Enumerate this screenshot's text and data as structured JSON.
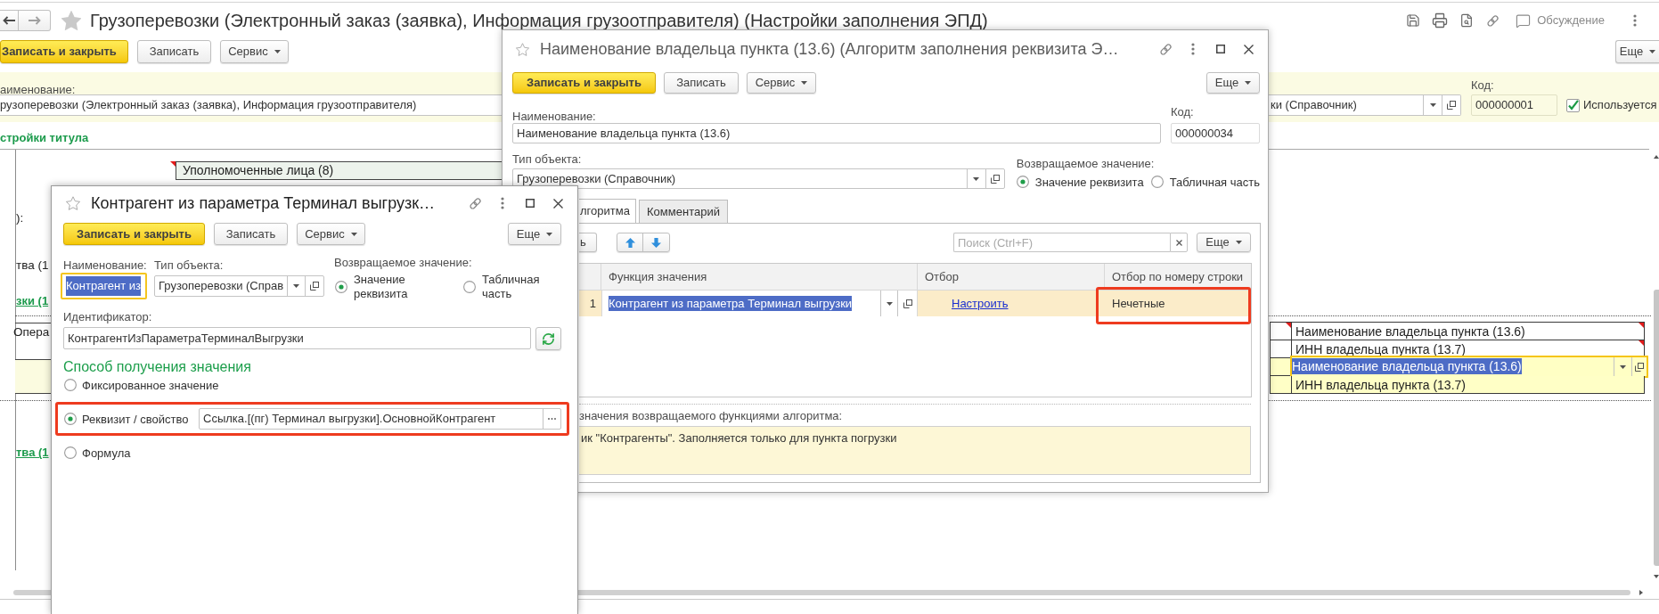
{
  "main_window": {
    "title": "Грузоперевозки (Электронный заказ (заявка), Информация грузоотправителя) (Настройки заполнения ЭПД)",
    "discussion_label": "Обсуждение",
    "toolbar": [
      {
        "label": "Записать и закрыть",
        "kind": "primary"
      },
      {
        "label": "Записать",
        "kind": "plain"
      },
      {
        "label": "Сервис",
        "kind": "menu"
      }
    ],
    "more_button": "Еще",
    "name_label": "аименование:",
    "name_value": "рузоперевозки (Электронный заказ (заявка), Информация грузоотправителя)",
    "type_value": "ки (Справочник)",
    "code_label": "Код:",
    "code_value": "000000001",
    "used": {
      "label": "Используется",
      "checked": true
    },
    "section_title": "стройки титула",
    "template": {
      "authorized_cell": {
        "text": "Уполномоченные лица (8)",
        "flagged": true
      },
      "left_fragments": [
        {
          "text": "):",
          "kind": "text"
        },
        {
          "text": "тва (1",
          "kind": "text"
        },
        {
          "text": "зки (1",
          "kind": "link"
        },
        {
          "text": "Опера",
          "kind": "text"
        },
        {
          "text": "тва (1",
          "kind": "link"
        }
      ],
      "owner_rows": [
        {
          "text": "Наименование владельца пункта (13.6)",
          "selected": false,
          "filled": false,
          "flagged": true
        },
        {
          "text": "ИНН владельца пункта (13.7)",
          "selected": false,
          "filled": false,
          "flagged": true
        },
        {
          "text": "Наименование владельца пункта (13.6)",
          "selected": true,
          "filled": true,
          "flagged": false
        },
        {
          "text": "ИНН владельца пункта (13.7)",
          "selected": false,
          "filled": true,
          "flagged": false
        }
      ]
    }
  },
  "algorithm_window": {
    "title": "Наименование владельца пункта (13.6) (Алгоритм заполнения реквизита Э…",
    "active": false,
    "toolbar": [
      {
        "label": "Записать и закрыть",
        "kind": "primary"
      },
      {
        "label": "Записать",
        "kind": "plain"
      },
      {
        "label": "Сервис",
        "kind": "menu"
      }
    ],
    "more_button": "Еще",
    "name_label": "Наименование:",
    "name_value": "Наименование владельца пункта (13.6)",
    "code_label": "Код:",
    "code_value": "000000034",
    "type_label": "Тип объекта:",
    "type_value": "Грузоперевозки (Справочник)",
    "return_label": "Возвращаемое значение:",
    "return_options": [
      {
        "label": "Значение реквизита",
        "selected": true
      },
      {
        "label": "Табличная часть",
        "selected": false
      }
    ],
    "tabs": [
      {
        "label": "лгоритма",
        "selected": true
      },
      {
        "label": "Комментарий",
        "selected": false
      }
    ],
    "add_button": "ь",
    "search_placeholder": "Поиск (Ctrl+F)",
    "table_more_button": "Еще",
    "table": {
      "columns": [
        "Функция значения",
        "Отбор",
        "Отбор по номеру строки"
      ],
      "rows": [
        {
          "number": "1",
          "function": "Контрагент из параметра Терминал выгрузки",
          "filter": "Настроить",
          "row_filter": "Нечетные",
          "selected": true,
          "editing": true,
          "row_filter_marked": true
        }
      ]
    },
    "description_label": "значения возвращаемого функциями алгоритма:",
    "description_value": "ик \"Контрагенты\". Заполняется только для пункта погрузки"
  },
  "parameter_window": {
    "title": "Контрагент из параметра Терминал выгрузк…",
    "active": true,
    "toolbar": [
      {
        "label": "Записать и закрыть",
        "kind": "primary"
      },
      {
        "label": "Записать",
        "kind": "plain"
      },
      {
        "label": "Сервис",
        "kind": "menu"
      }
    ],
    "more_button": "Еще",
    "name_label": "Наименование:",
    "name_value": "Контрагент из",
    "name_focused": true,
    "type_label": "Тип объекта:",
    "type_value": "Грузоперевозки (Справ",
    "return_label": "Возвращаемое значение:",
    "return_options": [
      {
        "label": "Значение реквизита",
        "selected": true
      },
      {
        "label": "Табличная часть",
        "selected": false
      }
    ],
    "id_label": "Идентификатор:",
    "id_value": "КонтрагентИзПараметраТерминалВыгрузки",
    "method_title": "Способ получения значения",
    "methods": [
      {
        "label": "Фиксированное значение",
        "kind": "plain",
        "selected": false,
        "marked": false
      },
      {
        "label": "Реквизит / свойство",
        "kind": "field",
        "value": "Ссылка.[(пг) Терминал выгрузки].ОсновнойКонтрагент",
        "selected": true,
        "marked": true
      },
      {
        "label": "Формула",
        "kind": "plain",
        "selected": false,
        "marked": false
      }
    ]
  }
}
